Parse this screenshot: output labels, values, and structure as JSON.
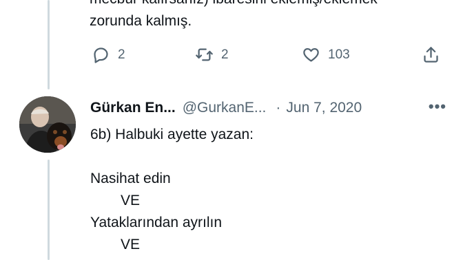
{
  "previous_tweet": {
    "line1": "mecbur kalırsanız) ibaresini eklemiş/eklemek",
    "line2": "zorunda kalmış.",
    "actions": {
      "reply_count": "2",
      "retweet_count": "2",
      "like_count": "103"
    }
  },
  "tweet": {
    "author_name": "Gürkan En...",
    "handle": "@GurkanE...",
    "separator": "·",
    "date": "Jun 7, 2020",
    "more_glyph": "•••",
    "lines": [
      "6b) Halbuki ayette yazan:",
      "",
      "Nasihat edin",
      "VE",
      "Yataklarından ayrılın",
      "VE"
    ]
  },
  "icons": [
    "reply-icon",
    "retweet-icon",
    "like-icon",
    "share-icon",
    "more-icon"
  ],
  "colors": {
    "text": "#0f1419",
    "secondary": "#536471",
    "thread_line": "#cfd9de"
  }
}
